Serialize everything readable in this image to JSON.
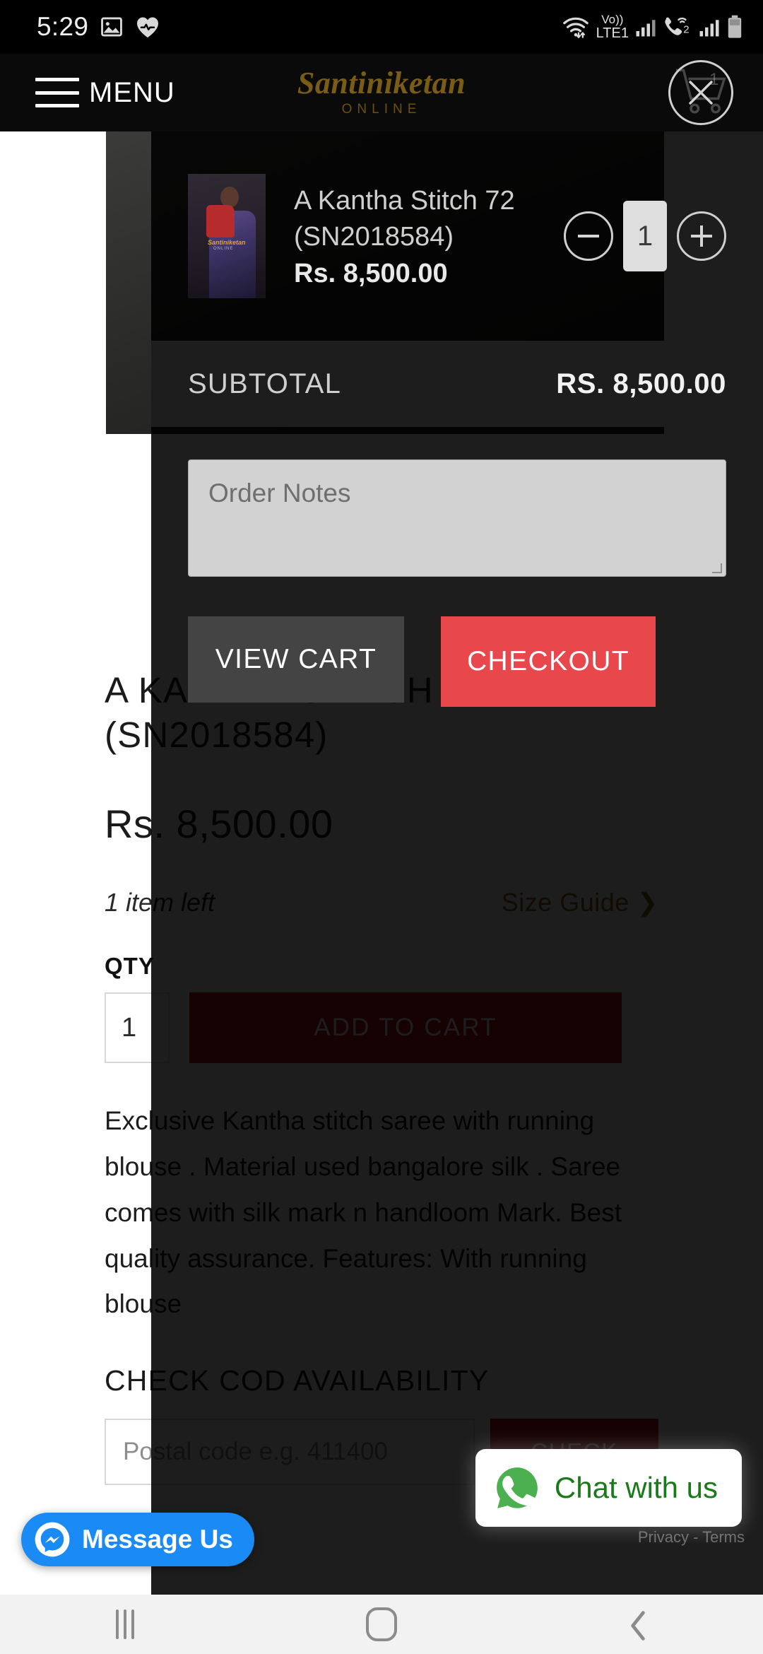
{
  "status_bar": {
    "time": "5:29",
    "left_icons": [
      "image-icon",
      "samsung-health-icon"
    ],
    "right_icons": [
      "wifi-icon",
      "volte-icon",
      "signal-sim1-icon",
      "vowifi-call-icon",
      "signal-sim2-icon",
      "battery-icon"
    ],
    "volte_top": "Vo))",
    "volte_bottom": "LTE1",
    "sim2_label": "2"
  },
  "header": {
    "menu_label": "MENU",
    "logo_main": "Santiniketan",
    "logo_sub": "ONLINE",
    "cart_count": "1",
    "close_icon": "close-icon"
  },
  "cart_drawer": {
    "item": {
      "name": "A Kantha Stitch 72 (SN2018584)",
      "price": "Rs. 8,500.00",
      "quantity": "1",
      "decrease_label": "minus-icon",
      "increase_label": "plus-icon"
    },
    "subtotal_label": "SUBTOTAL",
    "subtotal_value": "RS. 8,500.00",
    "notes_placeholder": "Order Notes",
    "notes_value": "",
    "view_cart_label": "VIEW CART",
    "checkout_label": "CHECKOUT",
    "colors": {
      "view_cart_bg": "#444444",
      "checkout_bg": "#e8484c",
      "notes_bg": "#d2d2d2",
      "subtotal_bg": "#1d1d1d"
    }
  },
  "product_page": {
    "title": "A KANTHA STITCH 72 (SN2018584)",
    "price": "Rs. 8,500.00",
    "stock": "1 item left",
    "size_guide": "Size Guide ❯",
    "qty_label": "QTY",
    "qty_value": "1",
    "add_to_cart_label": "ADD TO CART",
    "description": "Exclusive Kantha stitch saree with running blouse . Material used bangalore silk . Saree comes with silk mark n handloom Mark. Best quality assurance. Features: With running blouse",
    "cod_heading": "CHECK COD AVAILABILITY",
    "pincode_placeholder": "Postal code e.g. 411400",
    "check_label": "CHECK",
    "colors": {
      "accent_red": "#c4161c",
      "gold": "#8a6a17"
    }
  },
  "widgets": {
    "messenger_label": "Message Us",
    "messenger_bg": "#1a8af4",
    "whatsapp_label": "Chat with us",
    "whatsapp_color": "#1a7a1a",
    "privacy_terms": "Privacy - Terms"
  },
  "nav_bar": {
    "recents": "recents-icon",
    "home": "home-icon",
    "back": "back-icon"
  }
}
